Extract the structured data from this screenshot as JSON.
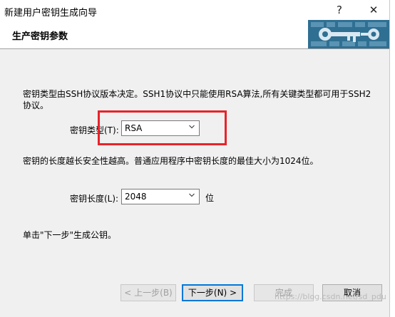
{
  "window": {
    "title": "新建用户密钥生成向导",
    "help_glyph": "?",
    "close_glyph": "✕"
  },
  "header": {
    "title": "生产密钥参数",
    "banner_icon": "key-banner-icon"
  },
  "content": {
    "type_description": "密钥类型由SSH协议版本决定。SSH1协议中只能使用RSA算法,所有关键类型都可用于SSH2协议。",
    "key_type_label": "密钥类型(T):",
    "key_type_value": "RSA",
    "length_description": "密钥的长度越长安全性越高。普通应用程序中密钥长度的最佳大小为1024位。",
    "key_length_label": "密钥长度(L):",
    "key_length_value": "2048",
    "key_length_unit": "位",
    "hint": "单击\"下一步\"生成公钥。"
  },
  "buttons": {
    "prev": "< 上一步(B)",
    "next": "下一步(N) >",
    "finish": "完成",
    "cancel": "取消"
  },
  "annotation": {
    "highlight_color": "#e8232a"
  },
  "watermark": "https://blog.csdn.net/sd_pdu"
}
